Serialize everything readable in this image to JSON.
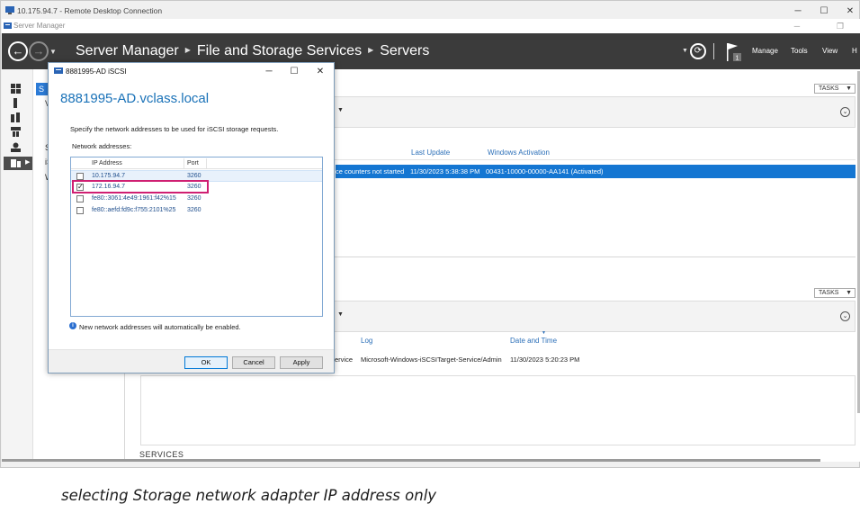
{
  "rdp": {
    "title": "10.175.94.7 - Remote Desktop Connection",
    "minimize": "─",
    "maximize": "☐",
    "close": "✕"
  },
  "app": {
    "title": "Server Manager",
    "minimize": "─",
    "restore": "❐",
    "breadcrumb": [
      "Server Manager",
      "File and Storage Services",
      "Servers"
    ],
    "menu": {
      "manage": "Manage",
      "tools": "Tools",
      "view": "View",
      "help": "H"
    },
    "notification_count": "1",
    "nav_selected": "S",
    "nav_items": [
      "V",
      "S",
      "iS",
      "W"
    ]
  },
  "servers_panel": {
    "tasks": "TASKS",
    "columns": {
      "last_update": "Last Update",
      "windows_activation": "Windows Activation"
    },
    "selected_row": {
      "status": "ce counters not started",
      "last_update": "11/30/2023 5:38:38 PM",
      "activation": "00431-10000-00000-AA141 (Activated)"
    }
  },
  "events_panel": {
    "tasks": "TASKS",
    "columns": {
      "log": "Log",
      "date_time": "Date and Time"
    },
    "row": {
      "source": "ervice",
      "log": "Microsoft-Windows-iSCSITarget-Service/Admin",
      "date_time": "11/30/2023 5:20:23 PM"
    }
  },
  "services_label": "SERVICES",
  "dialog": {
    "title": "8881995-AD iSCSI",
    "minimize": "─",
    "maximize": "☐",
    "close": "✕",
    "heading": "8881995-AD.vclass.local",
    "instruction": "Specify the network addresses to be used for iSCSI storage requests.",
    "list_label": "Network addresses:",
    "col_ip": "IP Address",
    "col_port": "Port",
    "rows": [
      {
        "ip": "10.175.94.7",
        "port": "3260",
        "checked": ""
      },
      {
        "ip": "172.16.94.7",
        "port": "3260",
        "checked": "✓"
      },
      {
        "ip": "fe80::3061:4e49:1961:f42%15",
        "port": "3260",
        "checked": ""
      },
      {
        "ip": "fe80::aefd:fd9c:f755:2101%25",
        "port": "3260",
        "checked": ""
      }
    ],
    "info": "New network addresses will automatically be enabled.",
    "ok": "OK",
    "cancel": "Cancel",
    "apply": "Apply"
  },
  "caption": "selecting Storage network adapter IP address only",
  "colors": {
    "accent": "#1476d2",
    "header_bg": "#3b3b3b",
    "highlight_box": "#cf1f72",
    "heading_blue": "#1a72b8"
  }
}
